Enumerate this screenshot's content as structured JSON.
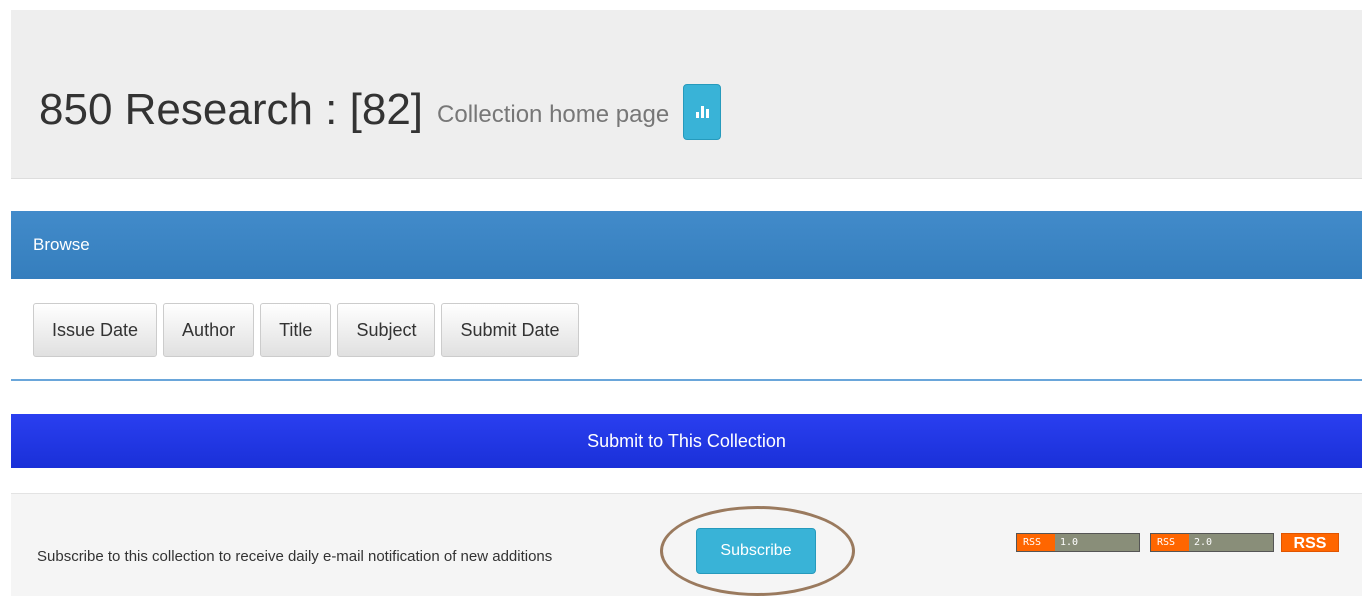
{
  "header": {
    "title": "850 Research : [82]",
    "subtitle": "Collection home page",
    "stats_icon": "bar-chart-icon"
  },
  "browse": {
    "heading": "Browse",
    "buttons": [
      "Issue Date",
      "Author",
      "Title",
      "Subject",
      "Submit Date"
    ]
  },
  "submit": {
    "label": "Submit to This Collection"
  },
  "subscribe": {
    "text": "Subscribe to this collection to receive daily e-mail notification of new additions",
    "button_label": "Subscribe"
  },
  "rss": {
    "feed1": {
      "left": "RSS",
      "right": "1.0"
    },
    "feed2": {
      "left": "RSS",
      "right": "2.0"
    },
    "feed3": "RSS"
  },
  "colors": {
    "browse_heading": "#428bca",
    "submit_bar": "#2a3ff0",
    "info_button": "#39b3d7",
    "rss_orange": "#ff6600",
    "annotation_circle": "#9a7a5e"
  }
}
